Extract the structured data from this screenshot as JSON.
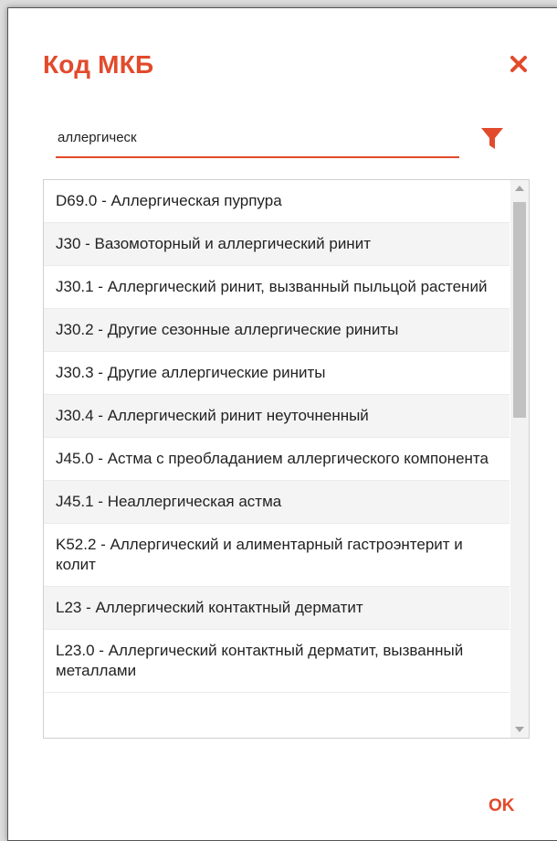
{
  "dialog": {
    "title": "Код МКБ",
    "search": {
      "value": "аллергическ",
      "placeholder": ""
    },
    "icons": {
      "close": "close-icon",
      "filter": "filter-icon"
    },
    "items": [
      {
        "label": "D69.0 - Аллергическая пурпура"
      },
      {
        "label": "J30 - Вазомоторный и аллергический ринит"
      },
      {
        "label": "J30.1 - Аллергический ринит, вызванный пыльцой растений"
      },
      {
        "label": "J30.2 - Другие сезонные аллергические риниты"
      },
      {
        "label": "J30.3 - Другие аллергические риниты"
      },
      {
        "label": "J30.4 - Аллергический ринит неуточненный"
      },
      {
        "label": "J45.0 - Астма с преобладанием аллергического компонента"
      },
      {
        "label": "J45.1 - Неаллергическая астма"
      },
      {
        "label": "K52.2 - Аллергический и алиментарный гастроэнтерит и колит"
      },
      {
        "label": "L23 - Аллергический контактный дерматит"
      },
      {
        "label": "L23.0 - Аллергический контактный дерматит, вызванный металлами"
      }
    ],
    "ok_label": "OK",
    "colors": {
      "accent": "#e24a2c"
    }
  }
}
